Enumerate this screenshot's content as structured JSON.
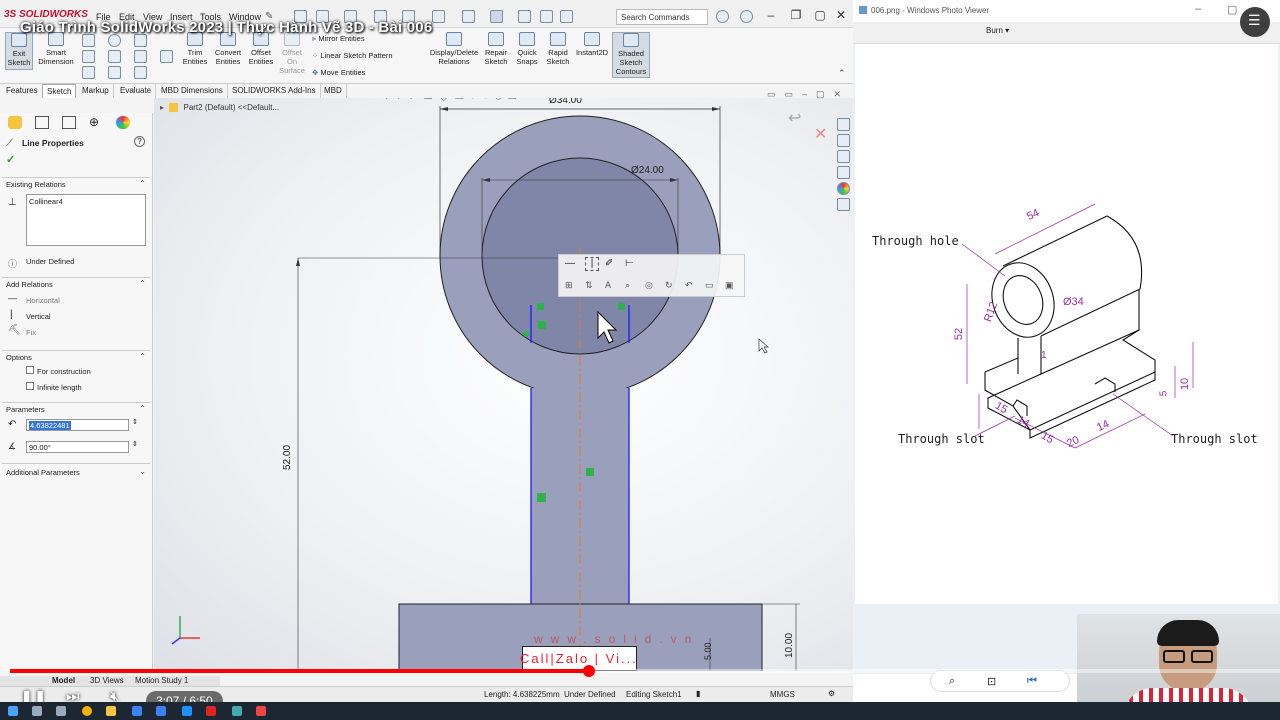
{
  "video": {
    "title": "Giáo Trình SolidWorks 2023 | Thực Hành Vẽ 3D - Bài 006",
    "time": "3:07 / 6:50",
    "progress": 0.456
  },
  "sw": {
    "logo": "3S SOLIDWORKS",
    "menu": [
      "File",
      "Edit",
      "View",
      "Insert",
      "Tools",
      "Window"
    ],
    "search_placeholder": "Search Commands",
    "ribbon": {
      "exit_sketch": "Exit Sketch",
      "smart_dimension": "Smart Dimension",
      "trim": "Trim Entities",
      "convert": "Convert Entities",
      "offset": "Offset Entities",
      "offset_surface": "Offset On Surface",
      "mirror": "Mirror Entities",
      "linear_pattern": "Linear Sketch Pattern",
      "move": "Move Entities",
      "display_delete": "Display/Delete Relations",
      "repair": "Repair Sketch",
      "quick_snaps": "Quick Snaps",
      "rapid_sketch": "Rapid Sketch",
      "instant2d": "Instant2D",
      "shaded": "Shaded Sketch Contours"
    },
    "tabs": [
      "Features",
      "Sketch",
      "Markup",
      "Evaluate",
      "MBD Dimensions",
      "SOLIDWORKS Add-Ins",
      "MBD"
    ],
    "active_tab": "Sketch",
    "tree_item": "Part2 (Default) <<Default..."
  },
  "pm": {
    "title": "Line Properties",
    "existing_relations": "Existing Relations",
    "relation_item": "Collinear4",
    "under_defined": "Under Defined",
    "add_relations": "Add Relations",
    "horizontal": "Horizontal",
    "vertical": "Vertical",
    "fix": "Fix",
    "options": "Options",
    "for_construction": "For construction",
    "infinite_length": "Infinite length",
    "parameters": "Parameters",
    "length_value": "4.63822481",
    "angle_value": "90.00°",
    "additional_parameters": "Additional Parameters"
  },
  "sketch": {
    "dim_outer": "Ø34.00",
    "dim_inner": "Ø24.00",
    "dim_height": "52.00",
    "dim_small": "5.00",
    "dim_right": "10.00",
    "watermark1": "www.solid.vn",
    "watermark2": "Call|Zalo | Vi..."
  },
  "status": {
    "length": "Length: 4.638225mm",
    "state": "Under Defined",
    "editing": "Editing Sketch1",
    "units": "MMGS",
    "bottom_tabs": [
      "Model",
      "3D Views",
      "Motion Study 1"
    ]
  },
  "viewer": {
    "title": "006.png - Windows Photo Viewer",
    "burn": "Burn",
    "labels": {
      "through_hole": "Through hole",
      "through_slot_left": "Through slot",
      "through_slot_right": "Through slot",
      "d54": "54",
      "d34": "Ø34",
      "r12": "R12",
      "d52": "52",
      "d1": "1",
      "d10": "10",
      "d5": "5",
      "d15a": "15",
      "d14a": "14",
      "d15b": "15",
      "d20": "20",
      "d14b": "14"
    }
  },
  "colors": {
    "accent": "#c8102e",
    "sketch_blue": "#1a1aff",
    "dim_purple": "#9b2ba8",
    "progress_red": "#ff0000"
  }
}
